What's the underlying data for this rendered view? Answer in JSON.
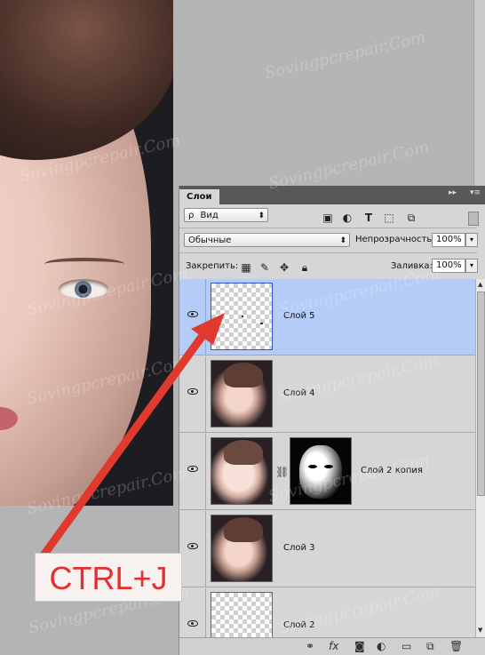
{
  "panel": {
    "tab_label": "Слои",
    "collapse_glyph": "▸▸",
    "menu_glyph": "▾≡",
    "filter": {
      "search_glyph": "ρ",
      "kind_value": "Вид"
    },
    "blend_mode": "Обычные",
    "opacity_label": "Непрозрачность:",
    "opacity_value": "100%",
    "lock_label": "Закрепить:",
    "fill_label": "Заливка:",
    "fill_value": "100%",
    "layers": [
      {
        "name": "Слой 5",
        "selected": true
      },
      {
        "name": "Слой 4",
        "selected": false
      },
      {
        "name": "Слой 2 копия",
        "selected": false,
        "has_mask": true
      },
      {
        "name": "Слой 3",
        "selected": false
      },
      {
        "name": "Слой 2",
        "selected": false
      }
    ],
    "bottom_icons": [
      "link-icon",
      "fx-icon",
      "mask-icon",
      "adjustment-icon",
      "folder-icon",
      "new-layer-icon",
      "trash-icon"
    ]
  },
  "callout": {
    "label": "CTRL+J"
  },
  "watermark": "Sovingpcrepair.Com",
  "colors": {
    "arrow": "#e0392e",
    "selected_layer": "#b5ccf6",
    "callout_text": "#e52f2f"
  }
}
